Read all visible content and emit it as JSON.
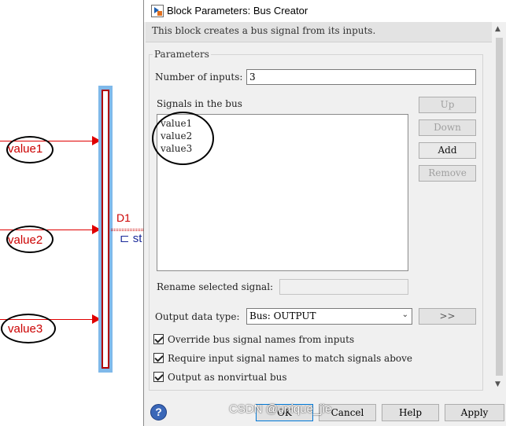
{
  "canvas": {
    "signals": [
      {
        "label": "value1"
      },
      {
        "label": "value2"
      },
      {
        "label": "value3"
      }
    ],
    "bus_line_label": "D1",
    "bus_selector_glyph": "⊏ st",
    "signal_color": "#e00000",
    "bus_block_color": "#7fb9ea"
  },
  "dialog": {
    "title": "Block Parameters: Bus Creator",
    "description": "This block creates a bus signal from its inputs.",
    "parameters_legend": "Parameters",
    "num_inputs_label": "Number of inputs:",
    "num_inputs_value": "3",
    "signals_label": "Signals in the bus",
    "signals": [
      "value1",
      "value2",
      "value3"
    ],
    "buttons": {
      "up": "Up",
      "down": "Down",
      "add": "Add",
      "remove": "Remove",
      "edit": ">>"
    },
    "rename_label": "Rename selected signal:",
    "rename_value": "",
    "output_type_label": "Output data type:",
    "output_type_value": "Bus: OUTPUT",
    "checkboxes": [
      {
        "label": "Override bus signal names from inputs",
        "checked": true
      },
      {
        "label": "Require input signal names to match signals above",
        "checked": true
      },
      {
        "label": "Output as nonvirtual bus",
        "checked": true
      }
    ],
    "footer": {
      "ok": "OK",
      "cancel": "Cancel",
      "help": "Help",
      "apply": "Apply"
    }
  },
  "watermark": "CSDN @unique_jie"
}
